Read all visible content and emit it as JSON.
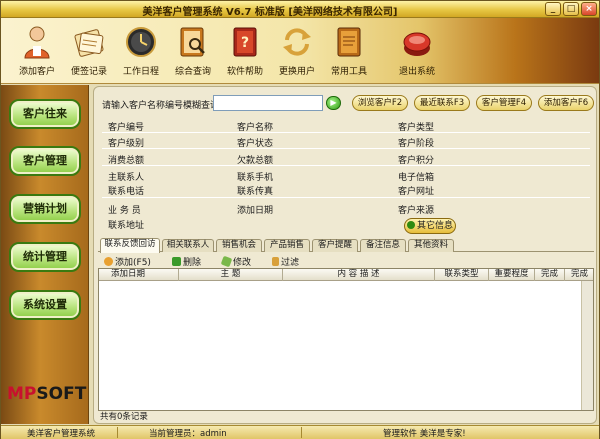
{
  "window": {
    "title": "美洋客户管理系统 V6.7 标准版 [美洋网络技术有限公司]",
    "min_label": "_",
    "max_label": "□",
    "close_label": "×"
  },
  "toolbar": {
    "items": [
      {
        "label": "添加客户",
        "icon": "person-icon"
      },
      {
        "label": "便签记录",
        "icon": "notepad-icon"
      },
      {
        "label": "工作日程",
        "icon": "clock-icon"
      },
      {
        "label": "综合查询",
        "icon": "search-book-icon"
      },
      {
        "label": "软件帮助",
        "icon": "help-book-icon"
      },
      {
        "label": "更换用户",
        "icon": "switch-user-icon"
      },
      {
        "label": "常用工具",
        "icon": "tools-book-icon"
      },
      {
        "label": "退出系统",
        "icon": "exit-icon"
      }
    ]
  },
  "sidebar": {
    "items": [
      {
        "label": "客户往来"
      },
      {
        "label": "客户管理"
      },
      {
        "label": "营销计划"
      },
      {
        "label": "统计管理"
      },
      {
        "label": "系统设置"
      }
    ],
    "logo_a": "MP",
    "logo_b": "SOFT"
  },
  "search": {
    "label": "请输入客户名称编号模糊查询",
    "value": "",
    "go_label": "▶",
    "buttons": [
      "浏览客户F2",
      "最近联系F3",
      "客户管理F4",
      "添加客户F6"
    ]
  },
  "fields": {
    "row1": [
      "客户编号",
      "客户名称",
      "客户类型"
    ],
    "row2": [
      "客户级别",
      "客户状态",
      "客户阶段"
    ],
    "row3": [
      "消费总额",
      "欠款总额",
      "客户积分"
    ],
    "row4": [
      "主联系人",
      "联系手机",
      "电子信箱"
    ],
    "row5": [
      "联系电话",
      "联系传真",
      "客户网址"
    ],
    "row6": [
      "业 务 员",
      "添加日期",
      "客户来源"
    ],
    "row7": [
      "联系地址"
    ],
    "other_button": "其它信息"
  },
  "tabs": [
    "联系反馈回访",
    "相关联系人",
    "销售机会",
    "产品销售",
    "客户提醒",
    "备注信息",
    "其他资料"
  ],
  "actions": [
    "添加(F5)",
    "删除",
    "修改",
    "过滤"
  ],
  "grid": {
    "columns": [
      "添加日期",
      "主 题",
      "内 容 描 述",
      "联系类型",
      "重要程度",
      "完成",
      "完成"
    ],
    "footer": "共有0条记录"
  },
  "status": {
    "app": "美洋客户管理系统",
    "admin": "当前管理员：admin",
    "slogan": "管理软件 美洋是专家!"
  }
}
